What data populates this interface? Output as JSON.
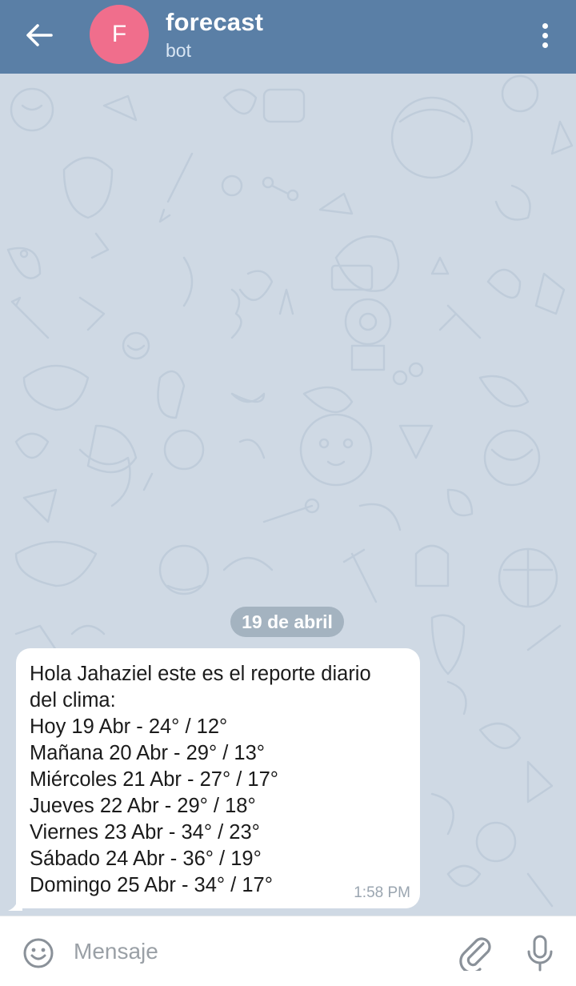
{
  "header": {
    "avatar_letter": "F",
    "title": "forecast",
    "subtitle": "bot",
    "avatar_color": "#f06e8c",
    "bar_color": "#5a7fa6"
  },
  "chat": {
    "date_label": "19 de abril",
    "message": {
      "lines": [
        "Hola Jahaziel este es el reporte diario",
        "del clima:",
        "Hoy 19 Abr - 24° / 12°",
        "Mañana 20 Abr - 29° / 13°",
        "Miércoles 21 Abr - 27° / 17°",
        "Jueves 22 Abr - 29° / 18°",
        "Viernes 23 Abr - 34° / 23°",
        "Sábado 24 Abr - 36° / 19°",
        "Domingo 25 Abr - 34° / 17°"
      ],
      "time": "1:58 PM"
    }
  },
  "input": {
    "placeholder": "Mensaje"
  },
  "icons": {
    "back": "arrow-left-icon",
    "menu": "more-vertical-icon",
    "emoji": "smiley-icon",
    "attach": "paperclip-icon",
    "mic": "microphone-icon"
  }
}
